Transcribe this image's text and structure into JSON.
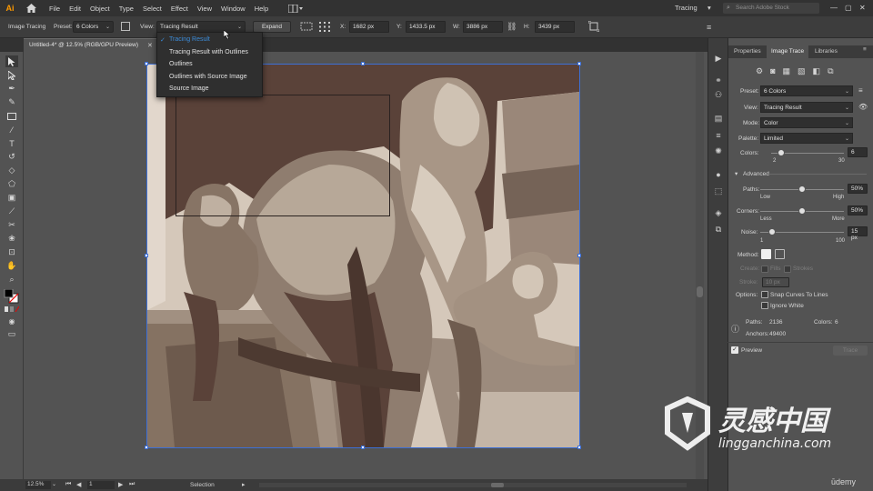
{
  "app": {
    "logo": "Ai",
    "workspace": "Tracing",
    "search_placeholder": "Search Adobe Stock"
  },
  "menu": [
    "File",
    "Edit",
    "Object",
    "Type",
    "Select",
    "Effect",
    "View",
    "Window",
    "Help"
  ],
  "control": {
    "title": "Image Tracing",
    "preset_label": "Preset:",
    "preset_value": "6 Colors",
    "view_label": "View:",
    "view_value": "Tracing Result",
    "expand": "Expand",
    "x_label": "X:",
    "x_value": "1682 px",
    "y_label": "Y:",
    "y_value": "1433.5 px",
    "w_label": "W:",
    "w_value": "3886 px",
    "h_label": "H:",
    "h_value": "3439 px"
  },
  "view_dropdown": {
    "options": [
      "Tracing Result",
      "Tracing Result with Outlines",
      "Outlines",
      "Outlines with Source Image",
      "Source Image"
    ],
    "selected_index": 0
  },
  "document": {
    "tab_title": "Untitled-4* @ 12.5% (RGB/GPU Preview)"
  },
  "status": {
    "zoom": "12.5%",
    "page": "1",
    "tool": "Selection"
  },
  "panel": {
    "tabs": [
      "Properties",
      "Image Trace",
      "Libraries"
    ],
    "active_tab": 1,
    "preset_label": "Preset:",
    "preset_value": "6 Colors",
    "view_label": "View:",
    "view_value": "Tracing Result",
    "mode_label": "Mode:",
    "mode_value": "Color",
    "palette_label": "Palette:",
    "palette_value": "Limited",
    "colors_label": "Colors:",
    "colors_value": "6",
    "colors_min": "2",
    "colors_max": "30",
    "colors_level": 0.14,
    "advanced": "Advanced",
    "paths_label": "Paths:",
    "paths_value": "50%",
    "paths_low": "Low",
    "paths_high": "High",
    "paths_level": 0.5,
    "corners_label": "Corners:",
    "corners_value": "50%",
    "corners_low": "Less",
    "corners_high": "More",
    "corners_level": 0.5,
    "noise_label": "Noise:",
    "noise_value": "15 px",
    "noise_min": "1",
    "noise_max": "100",
    "noise_level": 0.14,
    "method_label": "Method:",
    "create_label": "Create:",
    "fills_label": "Fills",
    "strokes_label": "Strokes",
    "stroke_label": "Stroke:",
    "stroke_value": "10 px",
    "options_label": "Options:",
    "snap_label": "Snap Curves To Lines",
    "ignore_label": "Ignore White",
    "paths_count_label": "Paths:",
    "paths_count": "2136",
    "colors_count_label": "Colors:",
    "colors_count": "6",
    "anchors_label": "Anchors:",
    "anchors_count": "49400",
    "preview_label": "Preview",
    "trace_label": "Trace"
  },
  "watermark": {
    "brand": "灵感中国",
    "url": "lingganchina.com",
    "udemy": "ūdemy"
  }
}
